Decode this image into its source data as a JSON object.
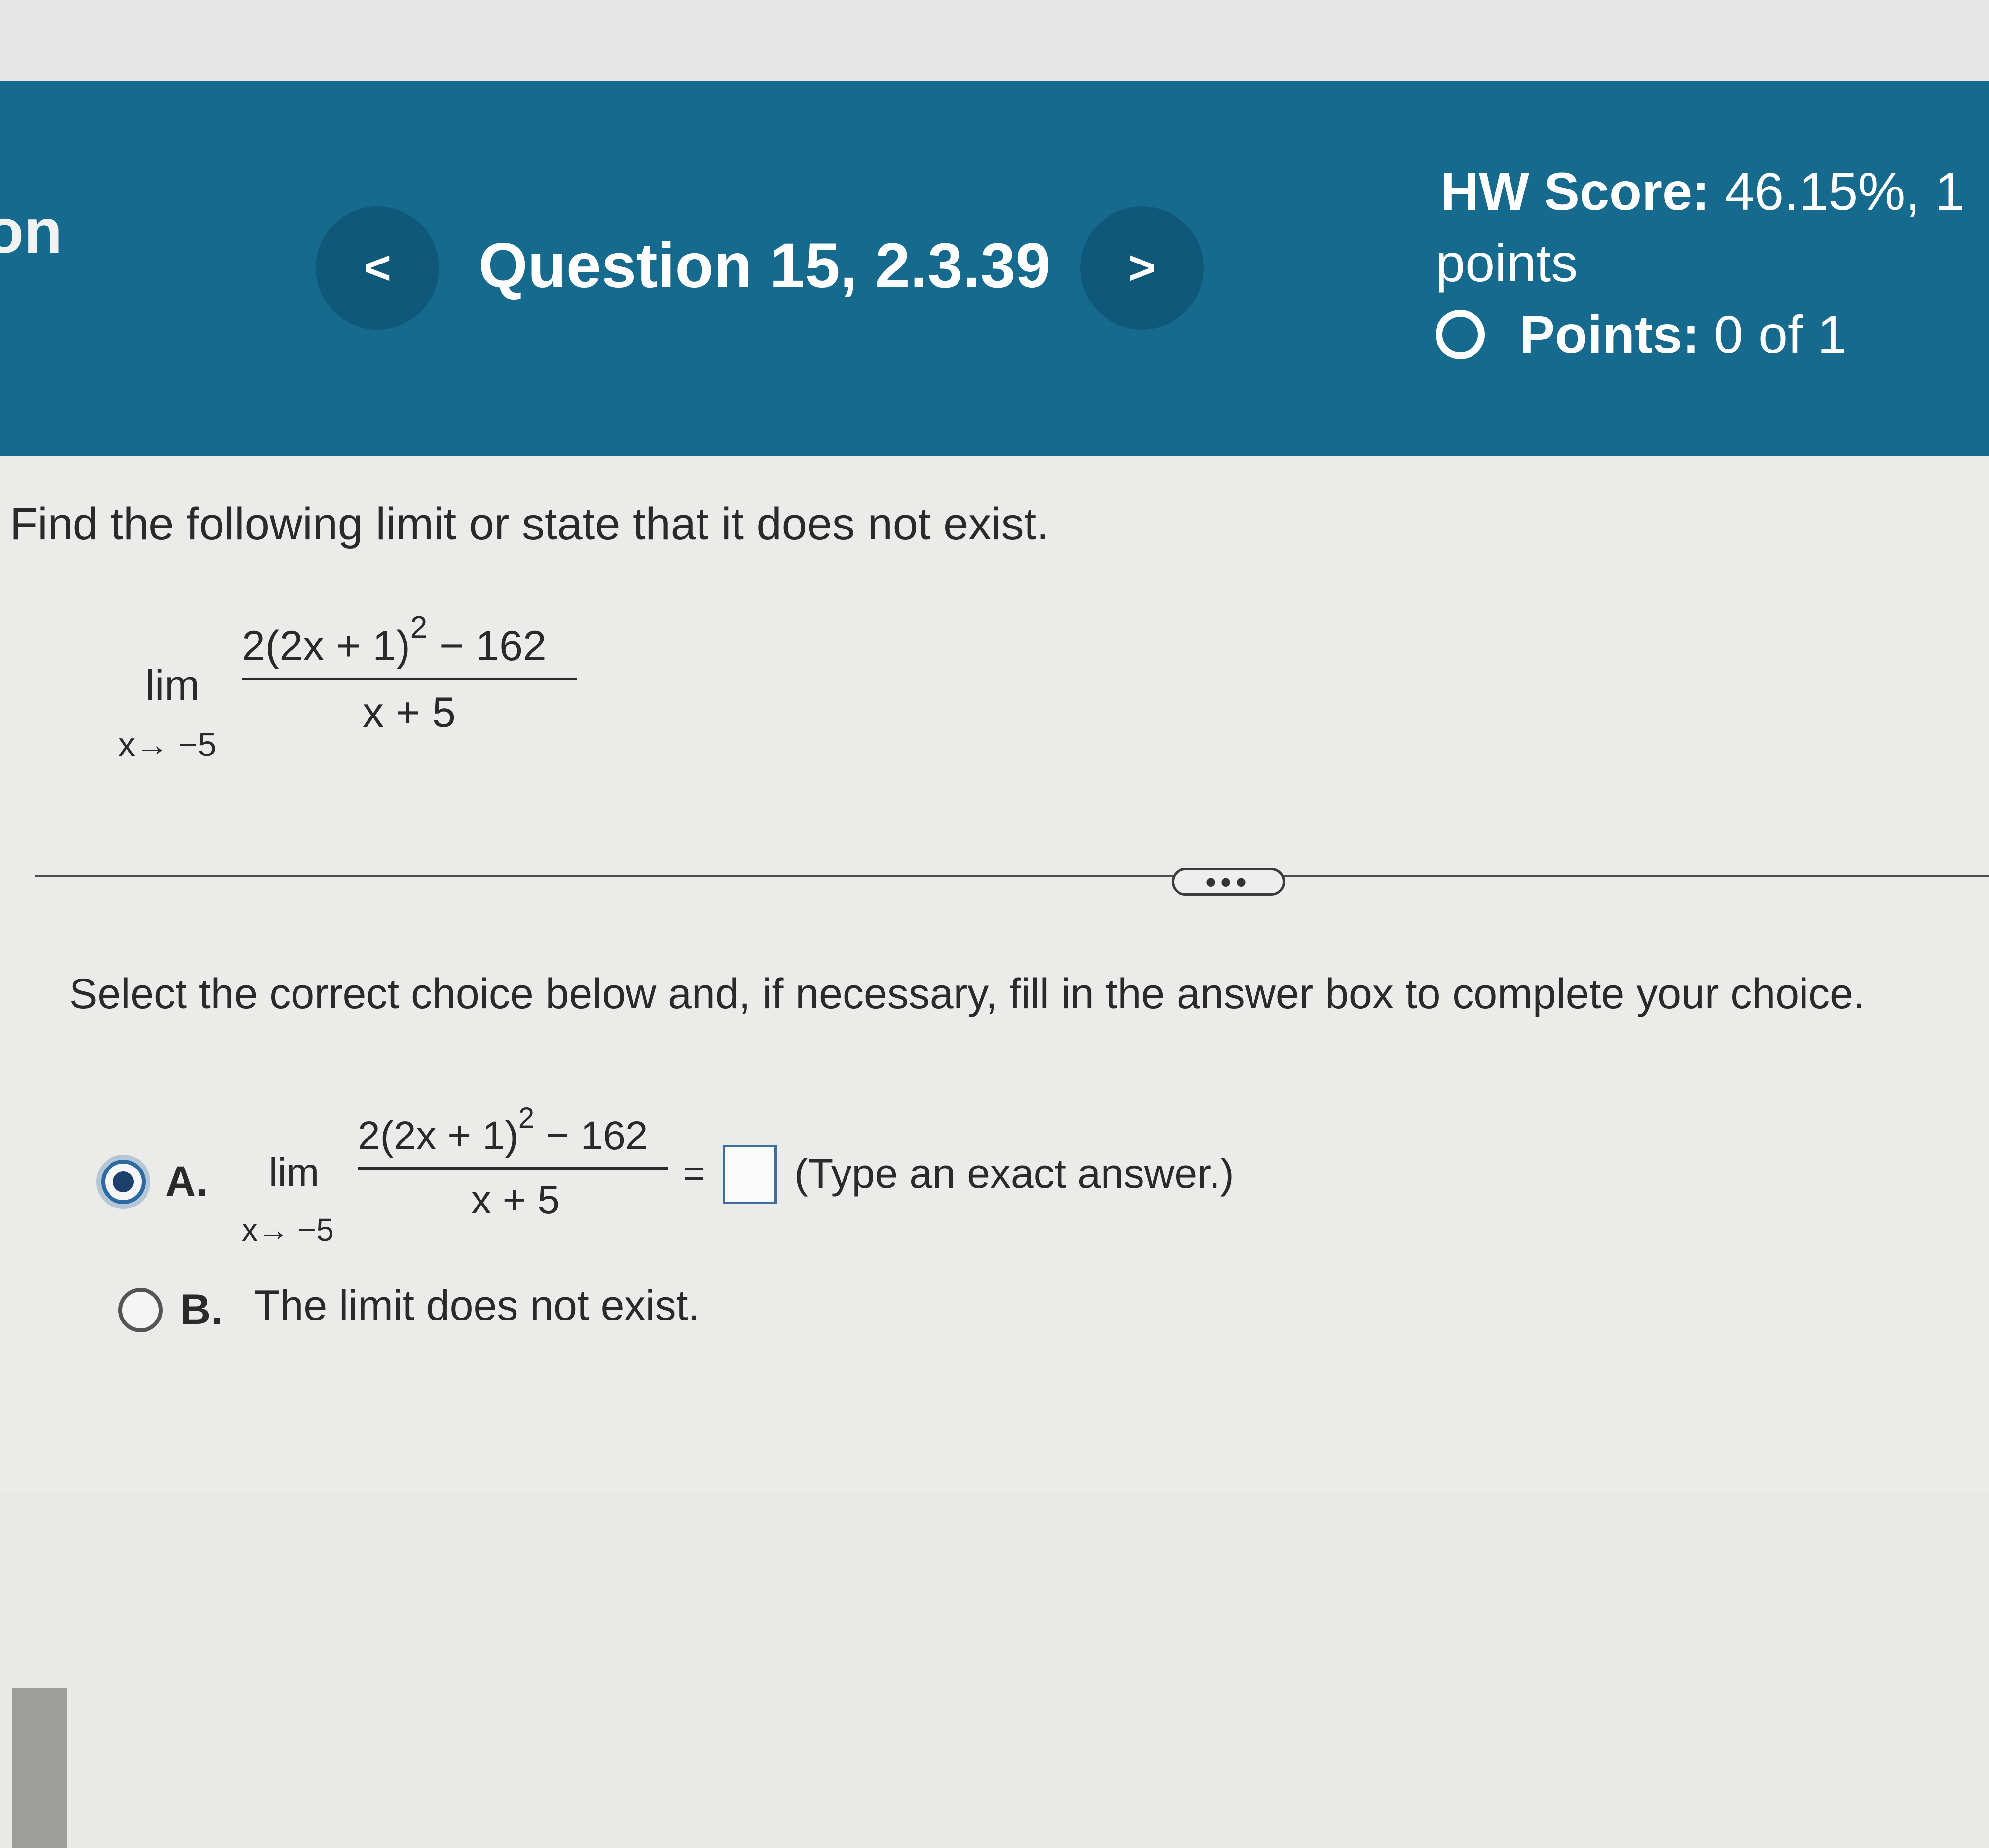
{
  "header": {
    "edge_text": "on",
    "prev_label": "<",
    "question_title": "Question 15, 2.3.39",
    "next_label": ">",
    "hw_score_label": "HW Score:",
    "hw_score_value": "46.15%, 1",
    "hw_points_text": "points",
    "points_label": "Points:",
    "points_value": "0 of 1"
  },
  "problem": {
    "prompt": "Find the following limit or state that it does not exist.",
    "lim_word": "lim",
    "lim_sub": "x→ −5",
    "numerator_base": "2(2x + 1)",
    "numerator_exp": "2",
    "numerator_tail": " − 162",
    "denominator": "x + 5"
  },
  "divider": {
    "more_label": "•••"
  },
  "answer": {
    "instruction": "Select the correct choice below and, if necessary, fill in the answer box to complete your choice.",
    "choice_a_letter": "A.",
    "choice_a_equals": "=",
    "choice_a_hint": "(Type an exact answer.)",
    "choice_a_value": "",
    "choice_b_letter": "B.",
    "choice_b_text": "The limit does not exist.",
    "selected": "A"
  },
  "colors": {
    "banner": "#156a8e",
    "nav_button": "#105879",
    "radio_selected": "#2c6aa2",
    "answer_box_border": "#3e6e9e"
  }
}
